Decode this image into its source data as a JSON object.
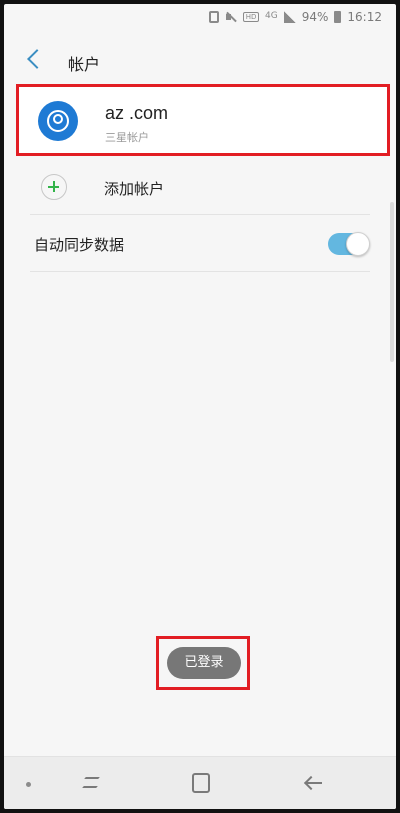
{
  "status_bar": {
    "battery": "94%",
    "time": "16:12",
    "hd_label": "HD",
    "lte_label": "4G"
  },
  "header": {
    "title": "帐户"
  },
  "account": {
    "email": "az                                    .com",
    "type": "三星帐户"
  },
  "add_account": {
    "label": "添加帐户"
  },
  "auto_sync": {
    "label": "自动同步数据",
    "enabled": true
  },
  "toast": {
    "text": "已登录"
  },
  "colors": {
    "accent": "#3b8ec2",
    "avatar": "#1e7ad4",
    "toggle_on": "#63b7e0",
    "add_plus": "#33b34a",
    "highlight_box": "#e21d23"
  },
  "icons": [
    "nfc-icon",
    "mute-icon",
    "hd-voice-icon",
    "lte-icon",
    "signal-icon",
    "battery-icon",
    "back-icon",
    "account-avatar-icon",
    "plus-icon",
    "recent-apps-icon",
    "home-icon",
    "back-nav-icon"
  ]
}
